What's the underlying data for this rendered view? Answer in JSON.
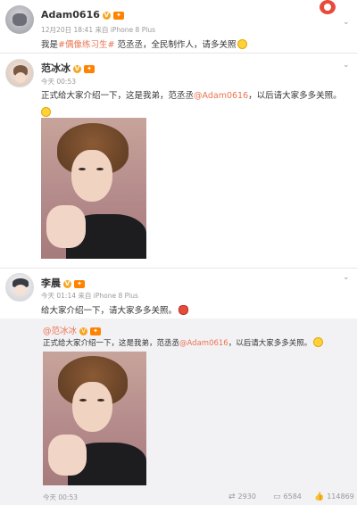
{
  "post1": {
    "author": "Adam0616",
    "meta": "12月20日 18:41 来自 iPhone 8 Plus",
    "text_prefix": "我是",
    "hashtag": "#偶像练习生#",
    "text_suffix": " 范丞丞，全民制作人，请多关照"
  },
  "post2": {
    "author": "范冰冰",
    "meta": "今天 00:53",
    "text_prefix": "正式给大家介绍一下，这是我弟，范丞丞",
    "mention": "@Adam0616",
    "text_suffix": "，以后请大家多多关照。"
  },
  "post3": {
    "author": "李晨",
    "meta": "今天 01:14 来自 iPhone 8 Plus",
    "text": "给大家介绍一下，请大家多多关照。"
  },
  "retweet": {
    "author": "@范冰冰",
    "text_prefix": "正式给大家介绍一下，这是我弟，范丞丞",
    "mention": "@Adam0616",
    "text_suffix": "，以后请大家多多关照。",
    "meta": "今天 00:53",
    "reposts": "2930",
    "comments": "6584",
    "likes": "114869"
  },
  "icons": {
    "chevron": "chevron-down-icon",
    "vip": "vip-badge",
    "level": "level-badge",
    "repost": "repost-icon",
    "comment": "comment-icon",
    "like": "like-icon"
  }
}
